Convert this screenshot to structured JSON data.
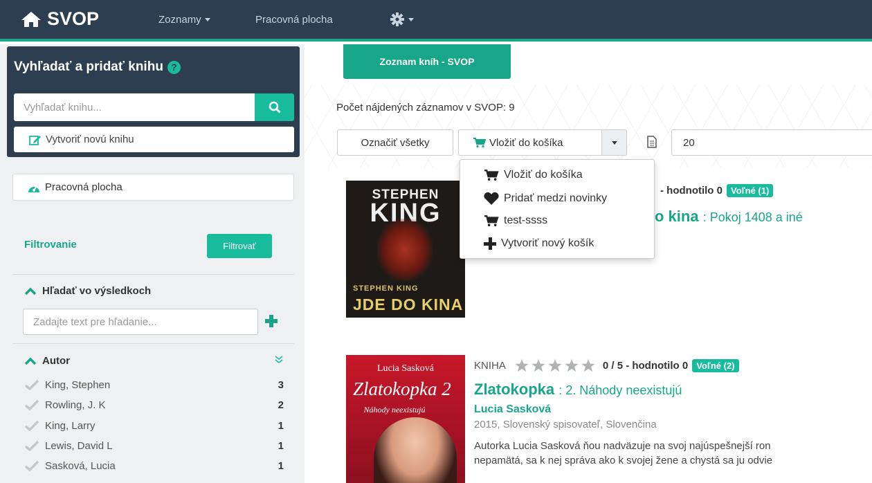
{
  "navbar": {
    "brand": "SVOP",
    "menu_lists": "Zoznamy",
    "menu_desktop": "Pracovná plocha"
  },
  "sidebar": {
    "search_title": "Vyhľadať a pridať knihu",
    "search_placeholder": "Vyhľadať knihu...",
    "create_label": "Vytvoriť novú knihu",
    "dashboard_label": "Pracovná plocha",
    "filter_label": "Filtrovanie",
    "filter_button": "Filtrovať",
    "results_title": "Hľadať vo výsledkoch",
    "results_placeholder": "Zadajte text pre hľadanie...",
    "author_title": "Autor",
    "authors": [
      {
        "name": "King, Stephen",
        "count": "3"
      },
      {
        "name": "Rowling, J. K",
        "count": "2"
      },
      {
        "name": "King, Larry",
        "count": "1"
      },
      {
        "name": "Lewis, David L",
        "count": "1"
      },
      {
        "name": "Sasková, Lucia",
        "count": "1"
      }
    ]
  },
  "main": {
    "tab_label": "Zoznam kníh - SVOP",
    "count_text": "Počet nájdených záznamov v SVOP: 9",
    "select_all": "Označiť všetky",
    "add_to_cart": "Vložiť do košíka",
    "page_size": "20",
    "dropdown": [
      "Vložiť do košíka",
      "Pridať medzi novinky",
      "test-ssss",
      "Vytvoriť nový košík"
    ]
  },
  "books": [
    {
      "cover_author_top": "STEPHEN",
      "cover_author_big": "KING",
      "cover_small": "STEPHEN KING",
      "cover_title": "JDE DO KINA",
      "meta_tail": "- hodnotilo 0",
      "badge": "Voľné (1)",
      "title_tail": "o kina",
      "subtitle": ": Pokoj 1408 a iné"
    },
    {
      "cover_author": "Lucia Sasková",
      "cover_title": "Zlatokopka",
      "cover_num": "2",
      "cover_sub": "Náhody neexistujú",
      "type": "KNIHA",
      "rating": "0 / 5 - hodnotilo 0",
      "rating_value": 0,
      "badge": "Voľné (2)",
      "title": "Zlatokopka",
      "subtitle": ": 2. Náhody neexistujú",
      "author": "Lucia Sasková",
      "pub": "2015, Slovenský spisovateľ, Slovenčina",
      "desc1": "Autorka Lucia Sasková ňou nadväzuje na svoj najúspešnejší ron",
      "desc2": "nepamätá, sa k nej správa ako k svojej žene a chystá sa ju odvie"
    }
  ],
  "colors": {
    "navbar": "#2c3e50",
    "accent": "#18bc9c",
    "accent_dark": "#18a689"
  }
}
